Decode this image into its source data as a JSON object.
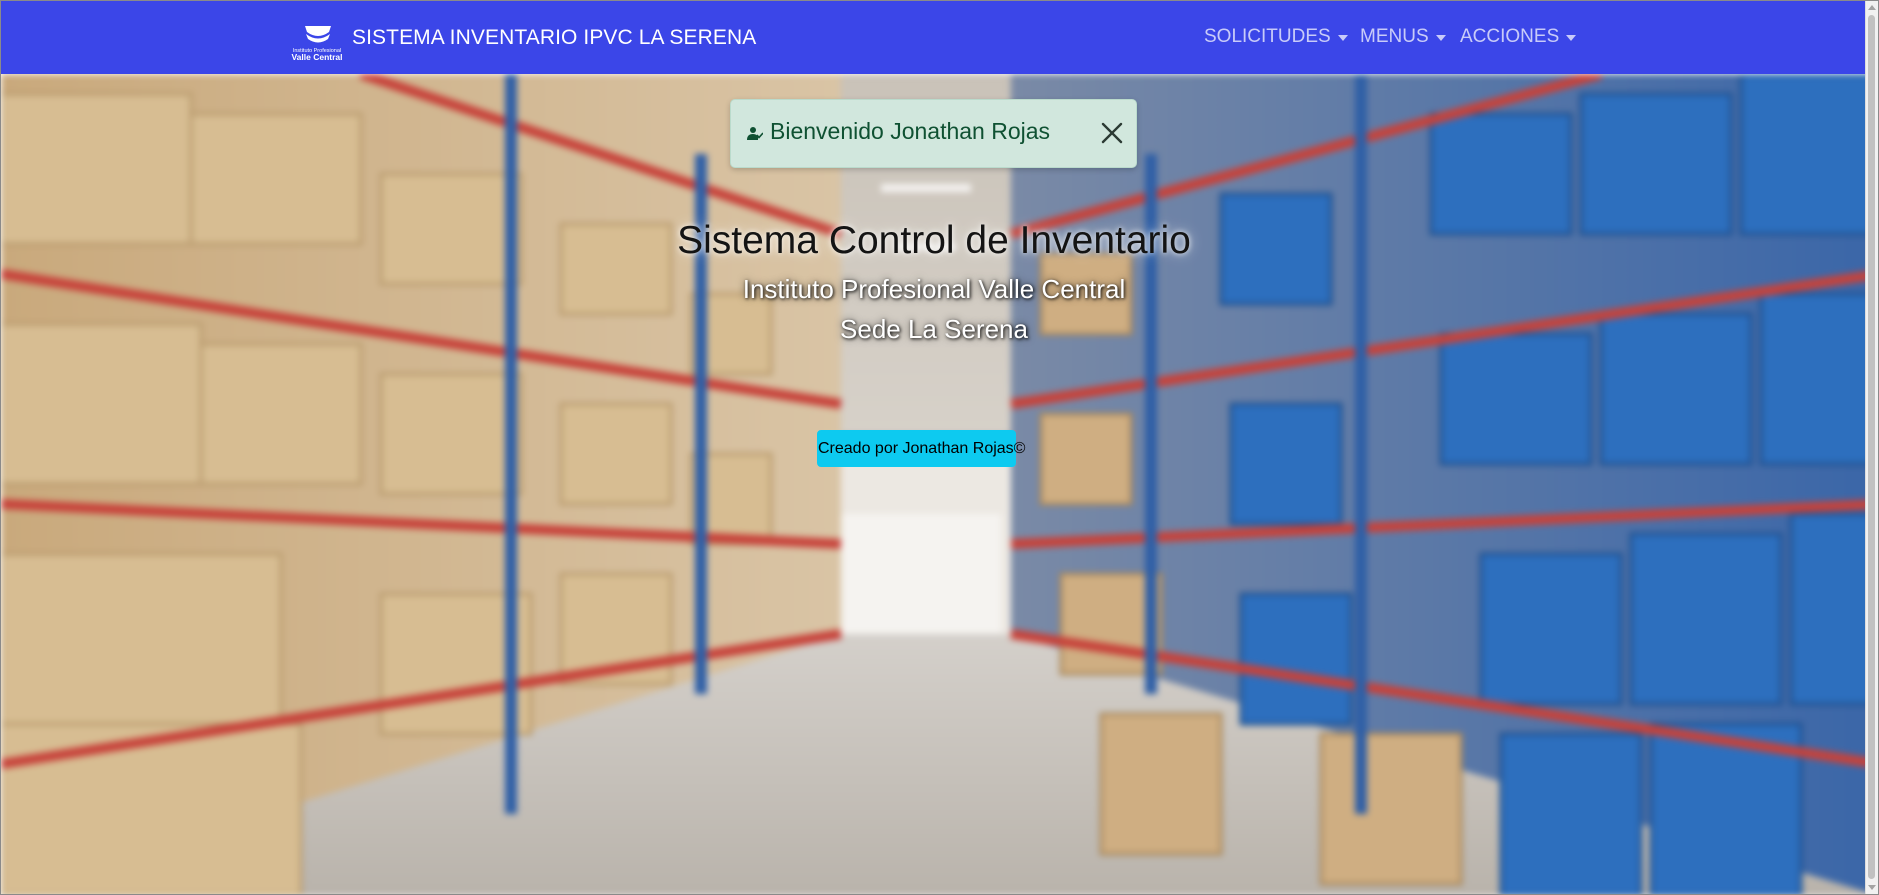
{
  "navbar": {
    "logo_lines": [
      "Instituto Profesional",
      "Valle Central"
    ],
    "brand_title": "SISTEMA INVENTARIO IPVC LA SERENA",
    "menu": [
      {
        "label": "SOLICITUDES"
      },
      {
        "label": "MENUS"
      },
      {
        "label": "ACCIONES"
      }
    ],
    "background_color": "#3b46e8"
  },
  "alert": {
    "icon": "user-check-icon",
    "message": "Bienvenido Jonathan Rojas",
    "close_icon": "close-icon",
    "background_color": "#d1e7dd",
    "text_color": "#0f5132"
  },
  "hero": {
    "title": "Sistema Control de Inventario",
    "subtitle_1": "Instituto Profesional Valle Central",
    "subtitle_2": "Sede La Serena",
    "credit_button": "Creado por Jonathan Rojas©",
    "credit_button_color": "#0dcaf0",
    "background_image": "blurred warehouse aisle with shelves of boxes"
  }
}
